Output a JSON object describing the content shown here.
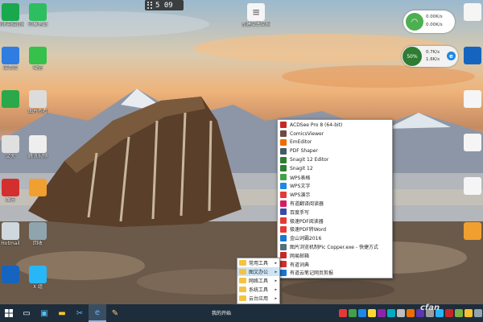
{
  "clock": {
    "time": "5 09"
  },
  "net_widget_top": {
    "icon": "wifi-icon",
    "down_speed": "0.00K/s",
    "up_speed": "0.00K/s"
  },
  "net_widget_bottom": {
    "percent": "50%",
    "down_speed": "0.7K/s",
    "up_speed": "1.6K/s"
  },
  "desktop_icons_left": [
    {
      "label": "腾讯电脑管家",
      "color": "#1aa84e",
      "icon": "shield-icon"
    },
    {
      "label": "印象笔记",
      "color": "#2dbe60",
      "icon": "evernote-icon"
    },
    {
      "label": "应用宝",
      "color": "#2f7de1",
      "icon": "grid-icon"
    },
    {
      "label": "微信",
      "color": "#35c14b",
      "icon": "wechat-icon"
    },
    {
      "label": "",
      "color": "#2aa84a",
      "icon": "app-icon"
    },
    {
      "label": "图片查看",
      "color": "#dcdcdc",
      "icon": "search-icon"
    },
    {
      "label": "文大",
      "color": "#e0e0e0",
      "icon": "app-icon"
    },
    {
      "label": "腾讯视频",
      "color": "#eeeeee",
      "icon": "file-icon"
    },
    {
      "label": "魔方",
      "color": "#d32f2f",
      "icon": "cube-icon"
    },
    {
      "label": "",
      "color": "#f0a030",
      "icon": "folder-icon"
    },
    {
      "label": "Hotmail",
      "color": "#cfd8dc",
      "icon": "mail-icon"
    },
    {
      "label": "回收",
      "color": "#90a4ae",
      "icon": "recycle-icon"
    },
    {
      "label": "",
      "color": "#1565c0",
      "icon": "app-icon"
    },
    {
      "label": "X 组",
      "color": "#29b6f6",
      "icon": "app-icon"
    }
  ],
  "desktop_icons_right": [
    {
      "label": "",
      "color": "#f5f5f5",
      "icon": "file-icon"
    },
    {
      "label": "",
      "color": "#1565c0",
      "icon": "app-icon"
    },
    {
      "label": "",
      "color": "#f5f5f5",
      "icon": "file-icon"
    },
    {
      "label": "",
      "color": "#f5f5f5",
      "icon": "file-icon"
    },
    {
      "label": "",
      "color": "#f5f5f5",
      "icon": "file-icon"
    },
    {
      "label": "",
      "color": "#f0a030",
      "icon": "folder-icon"
    }
  ],
  "desktop_doc": {
    "label": "新建文本文档"
  },
  "category_menu": [
    {
      "label": "常用工具"
    },
    {
      "label": "图文办公"
    },
    {
      "label": "网络工具"
    },
    {
      "label": "系统工具"
    },
    {
      "label": "云台应用"
    }
  ],
  "submenu": [
    {
      "label": "ACDSee Pro 8 (64-bit)",
      "color": "#c62828"
    },
    {
      "label": "ComicsViewer",
      "color": "#6d4c41"
    },
    {
      "label": "EmEditor",
      "color": "#ef6c00"
    },
    {
      "label": "PDF Shaper",
      "color": "#455a64"
    },
    {
      "label": "Snagit 12 Editor",
      "color": "#2e7d32"
    },
    {
      "label": "Snagit 12",
      "color": "#2e7d32"
    },
    {
      "label": "WPS表格",
      "color": "#43a047"
    },
    {
      "label": "WPS文字",
      "color": "#1e88e5"
    },
    {
      "label": "WPS演示",
      "color": "#e53935"
    },
    {
      "label": "有道翻译阅读器",
      "color": "#d81b60"
    },
    {
      "label": "百度手写",
      "color": "#3949ab"
    },
    {
      "label": "极速PDF阅读器",
      "color": "#e53935"
    },
    {
      "label": "极速PDF转Word",
      "color": "#e53935"
    },
    {
      "label": "金山词霸2016",
      "color": "#1976d2"
    },
    {
      "label": "图片浏览机制Pic Copper.exe - 快捷方式",
      "color": "#546e7a"
    },
    {
      "label": "网易邮箱",
      "color": "#c62828"
    },
    {
      "label": "有道词典",
      "color": "#d32f2f"
    },
    {
      "label": "有道云笔记网页剪报",
      "color": "#1976d2"
    }
  ],
  "taskbar": {
    "start_label": "我的开始",
    "buttons": [
      "start-icon",
      "task-view-icon",
      "store-icon",
      "explorer-icon",
      "screenshot-icon",
      "edge-icon",
      "notes-icon"
    ]
  },
  "watermark": {
    "text": "cfan"
  }
}
